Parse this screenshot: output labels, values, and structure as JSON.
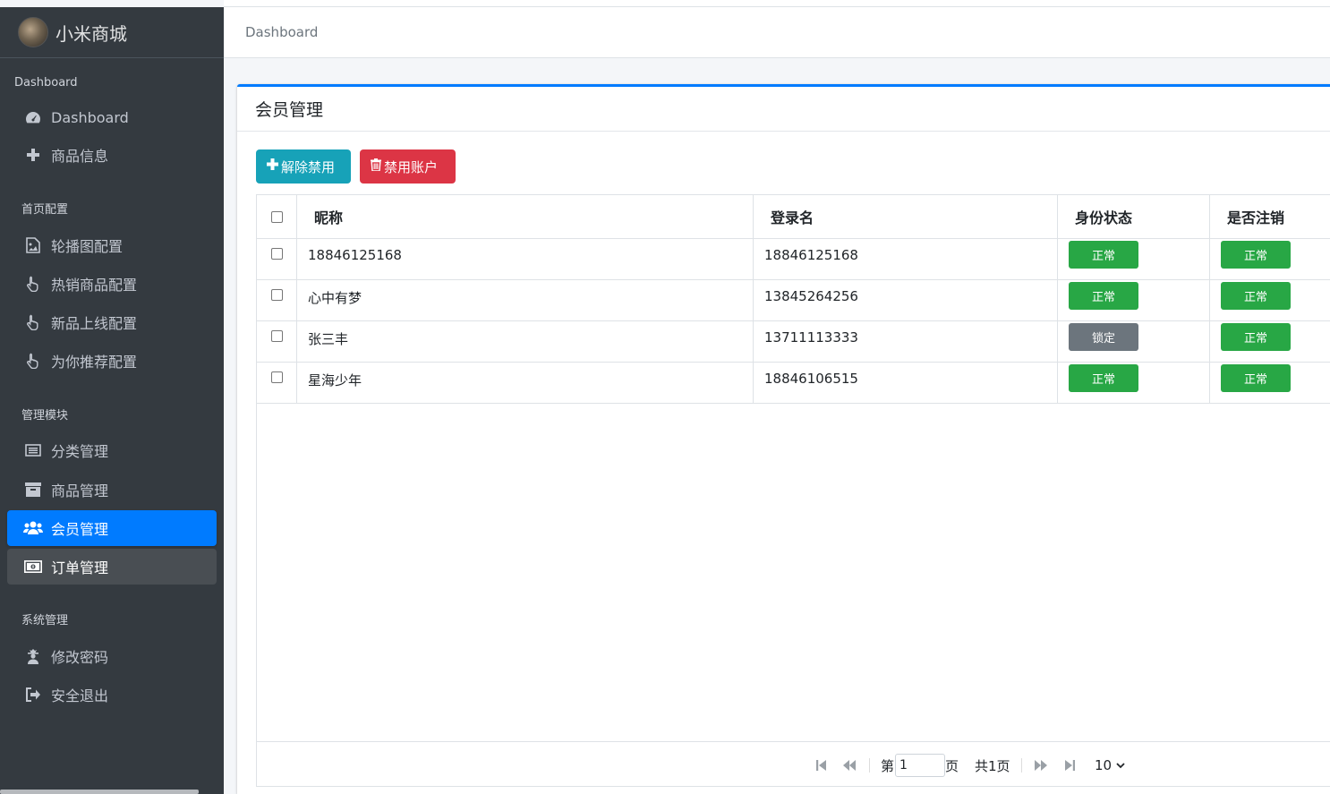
{
  "sidebar": {
    "brand": "小米商城",
    "sections": {
      "dashboard": "Dashboard",
      "home_config": "首页配置",
      "manage": "管理模块",
      "system": "系统管理"
    },
    "items": {
      "dashboard": "Dashboard",
      "goods_info": "商品信息",
      "carousel": "轮播图配置",
      "hot_goods": "热销商品配置",
      "new_goods": "新品上线配置",
      "recommend": "为你推荐配置",
      "category": "分类管理",
      "goods_manage": "商品管理",
      "member_manage": "会员管理",
      "order_manage": "订单管理",
      "change_password": "修改密码",
      "logout": "安全退出"
    }
  },
  "topbar": {
    "breadcrumb": "Dashboard"
  },
  "card": {
    "title": "会员管理",
    "unban_label": "解除禁用",
    "ban_label": "禁用账户"
  },
  "table": {
    "headers": {
      "nick": "昵称",
      "login": "登录名",
      "status": "身份状态",
      "cancel": "是否注销"
    },
    "rows": [
      {
        "nick": "18846125168",
        "login": "18846125168",
        "status": "正常",
        "cancel": "正常"
      },
      {
        "nick": "心中有梦",
        "login": "13845264256",
        "status": "正常",
        "cancel": "正常"
      },
      {
        "nick": "张三丰",
        "login": "13711113333",
        "status": "锁定",
        "cancel": "正常"
      },
      {
        "nick": "星海少年",
        "login": "18846106515",
        "status": "正常",
        "cancel": "正常"
      }
    ]
  },
  "pager": {
    "page_prefix": "第",
    "page_value": "1",
    "page_suffix": "页",
    "total": "共1页",
    "page_size": "10"
  },
  "colors": {
    "primary": "#007bff",
    "success": "#28a745",
    "danger": "#dc3545",
    "info": "#17a2b8",
    "secondary": "#6c757d",
    "sidebar": "#343a40"
  }
}
